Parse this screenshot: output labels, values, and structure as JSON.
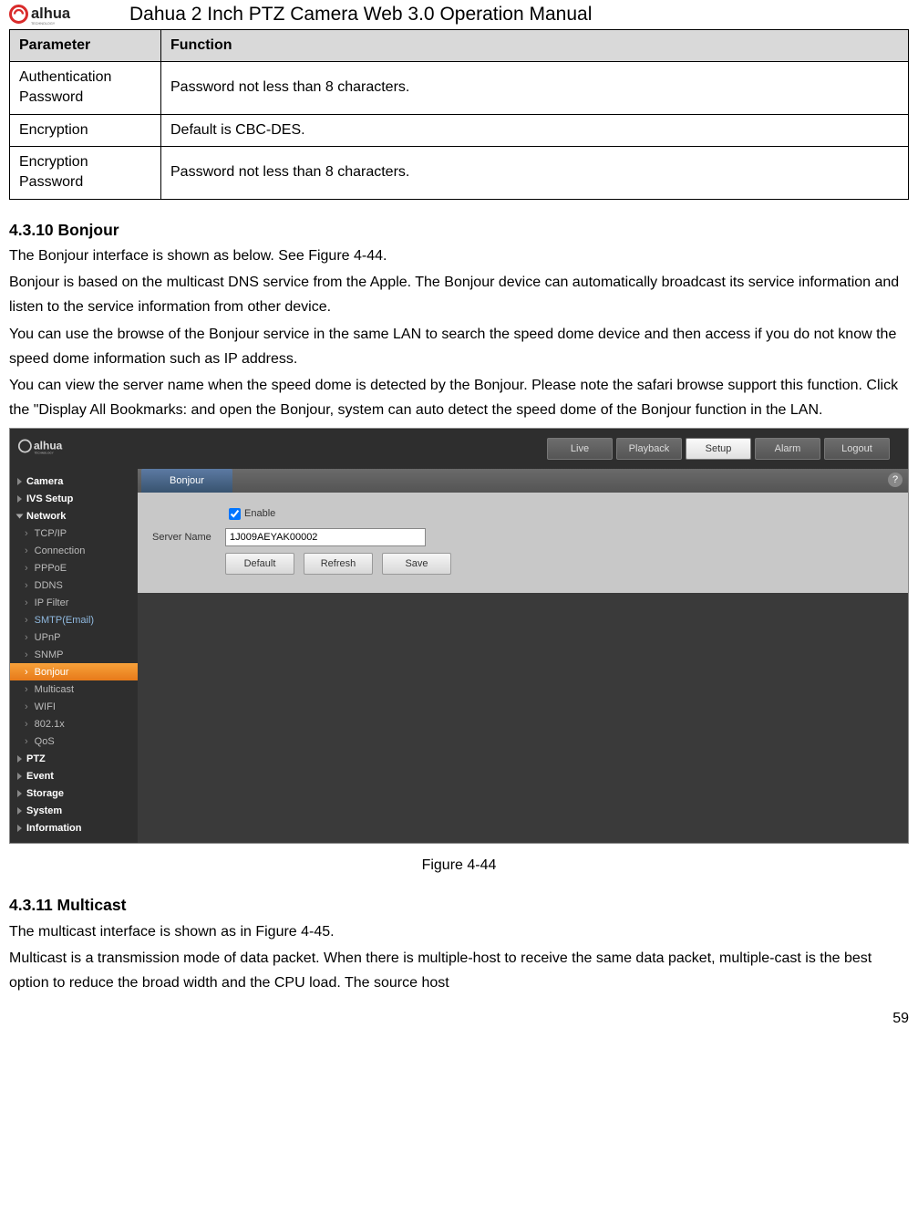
{
  "doc_title": "Dahua 2 Inch PTZ Camera Web 3.0 Operation Manual",
  "brand": "alhua",
  "param_table": {
    "headers": [
      "Parameter",
      "Function"
    ],
    "rows": [
      [
        "Authentication Password",
        "Password not less than 8 characters."
      ],
      [
        "Encryption",
        "Default is CBC-DES."
      ],
      [
        "Encryption Password",
        "Password not less than 8 characters."
      ]
    ]
  },
  "section1": {
    "heading": "4.3.10 Bonjour",
    "p1": "The Bonjour interface is shown as below. See Figure 4-44.",
    "p2": "Bonjour is based on the multicast DNS service from the Apple. The Bonjour device can automatically broadcast its service information and listen to the service information from other device.",
    "p3": "You can use the browse of the Bonjour service in the same LAN to search the speed dome  device and then access if you do not know the speed dome  information such as IP address.",
    "p4": "You can view the server name when the speed dome is detected by the Bonjour. Please note the safari browse support this function. Click the \"Display All Bookmarks: and open the Bonjour, system can auto detect the speed dome of the Bonjour function in the LAN."
  },
  "screenshot": {
    "logo_text": "alhua",
    "top_tabs": [
      "Live",
      "Playback",
      "Setup",
      "Alarm",
      "Logout"
    ],
    "active_top_tab": "Setup",
    "sidebar": [
      {
        "type": "cat",
        "label": "Camera",
        "expanded": false
      },
      {
        "type": "cat",
        "label": "IVS Setup",
        "expanded": false
      },
      {
        "type": "cat",
        "label": "Network",
        "expanded": true
      },
      {
        "type": "sub",
        "label": "TCP/IP"
      },
      {
        "type": "sub",
        "label": "Connection"
      },
      {
        "type": "sub",
        "label": "PPPoE"
      },
      {
        "type": "sub",
        "label": "DDNS"
      },
      {
        "type": "sub",
        "label": "IP Filter"
      },
      {
        "type": "sub",
        "label": "SMTP(Email)",
        "blue": true
      },
      {
        "type": "sub",
        "label": "UPnP"
      },
      {
        "type": "sub",
        "label": "SNMP"
      },
      {
        "type": "sub",
        "label": "Bonjour",
        "active": true
      },
      {
        "type": "sub",
        "label": "Multicast"
      },
      {
        "type": "sub",
        "label": "WIFI"
      },
      {
        "type": "sub",
        "label": "802.1x"
      },
      {
        "type": "sub",
        "label": "QoS"
      },
      {
        "type": "cat",
        "label": "PTZ",
        "expanded": false
      },
      {
        "type": "cat",
        "label": "Event",
        "expanded": false
      },
      {
        "type": "cat",
        "label": "Storage",
        "expanded": false
      },
      {
        "type": "cat",
        "label": "System",
        "expanded": false
      },
      {
        "type": "cat",
        "label": "Information",
        "expanded": false
      }
    ],
    "panel_tab": "Bonjour",
    "enable_label": "Enable",
    "enable_checked": true,
    "server_name_label": "Server Name",
    "server_name_value": "1J009AEYAK00002",
    "buttons": [
      "Default",
      "Refresh",
      "Save"
    ],
    "help_icon": "?"
  },
  "figure_caption": "Figure 4-44",
  "section2": {
    "heading": "4.3.11 Multicast",
    "p1": "The multicast interface is shown as in Figure 4-45.",
    "p2": "Multicast is a transmission mode of data packet. When there is multiple-host to receive the same data packet, multiple-cast is the best option to reduce the broad width and the CPU load.  The source host"
  },
  "page_number": "59"
}
